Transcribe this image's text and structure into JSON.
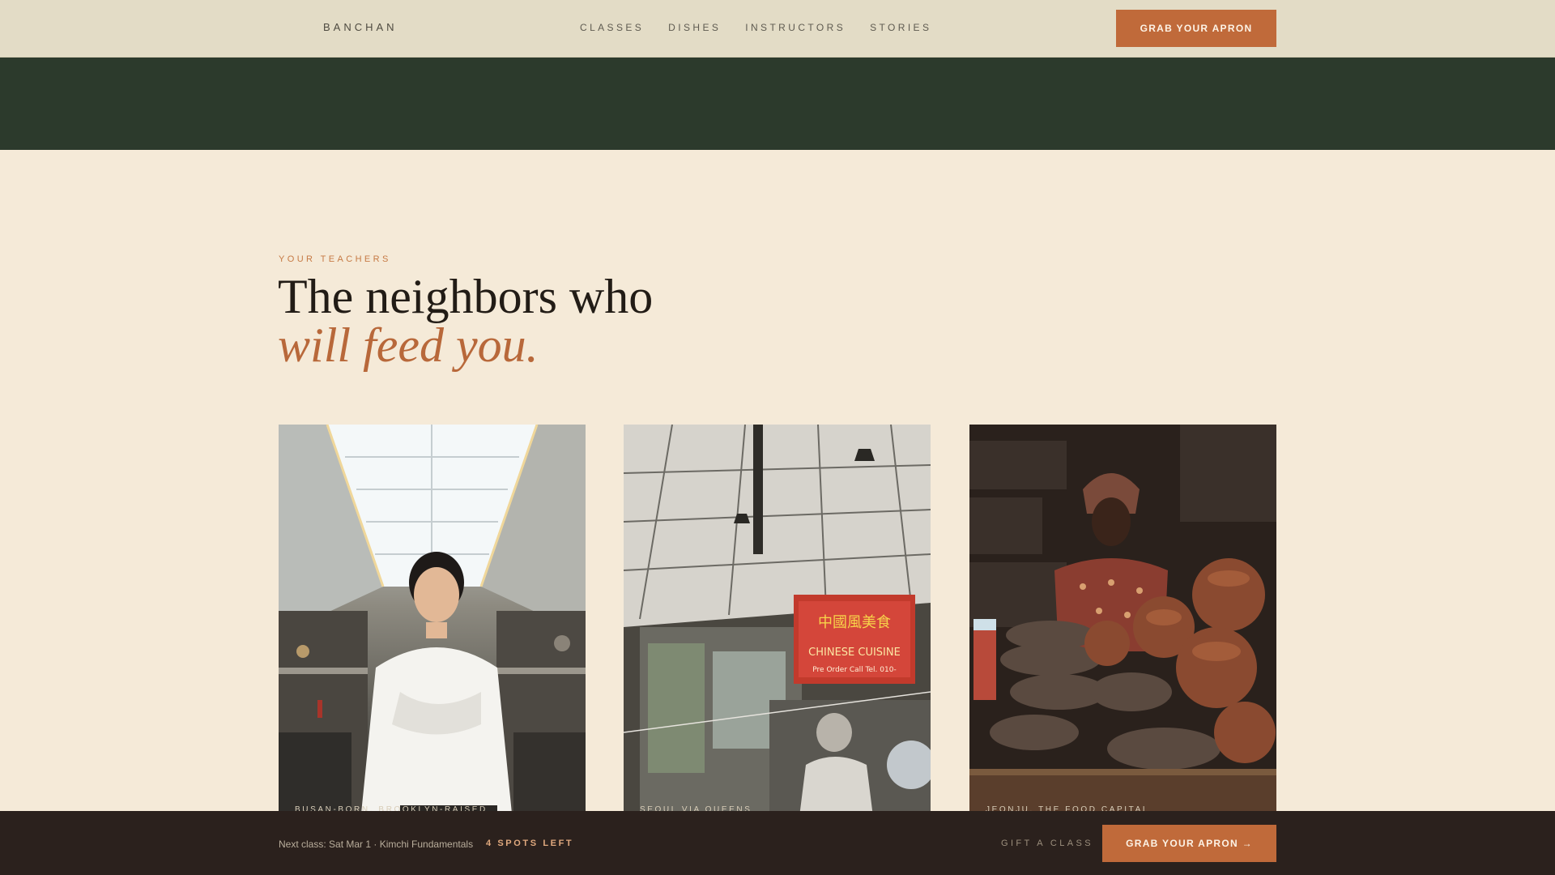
{
  "nav": {
    "brand": "BANCHAN",
    "links": [
      "CLASSES",
      "DISHES",
      "INSTRUCTORS",
      "STORIES"
    ],
    "cta_label": "GRAB YOUR APRON"
  },
  "section": {
    "eyebrow": "YOUR TEACHERS",
    "headline": "The neighbors who",
    "headline_accent": "will feed you."
  },
  "instructors": [
    {
      "caption": "BUSAN-BORN, BROOKLYN-RAISED",
      "photo": "chef-in-kitchen-photo"
    },
    {
      "caption": "SEOUL VIA QUEENS",
      "photo": "street-food-stall-photo",
      "sign_text": [
        "中國風美食",
        "CHINESE CUISINE",
        "Pre Order Call Tel. 010-"
      ]
    },
    {
      "caption": "JEONJU, THE FOOD CAPITAL",
      "photo": "pottery-market-photo"
    }
  ],
  "bottom_bar": {
    "next_class": "Next class: Sat Mar 1 · Kimchi Fundamentals",
    "spots": "4 SPOTS LEFT",
    "gift_label": "GIFT A CLASS",
    "cta_label": "GRAB YOUR APRON →"
  },
  "colors": {
    "accent": "#c06a3a",
    "cream": "#f5ead8",
    "forest": "#2c3a2c",
    "dark_bar": "#2b211d"
  }
}
